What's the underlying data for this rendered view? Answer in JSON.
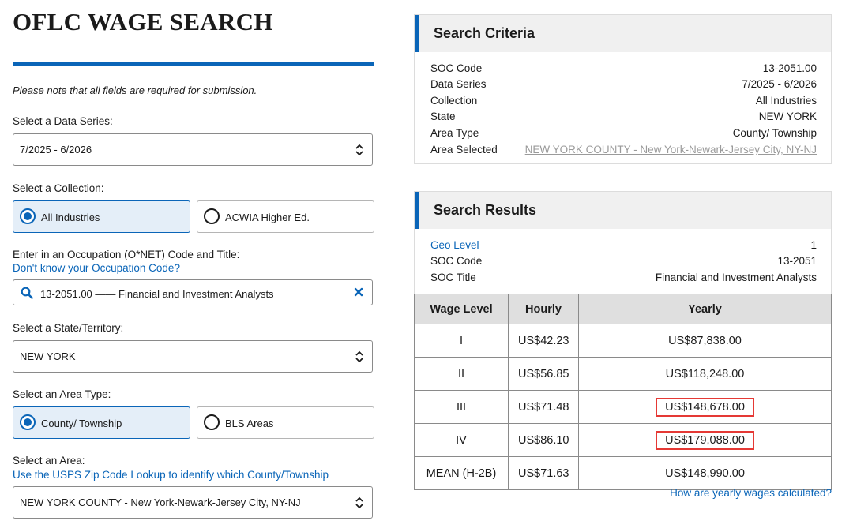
{
  "form": {
    "title": "OFLC WAGE SEARCH",
    "note": "Please note that all fields are required for submission.",
    "data_series": {
      "label": "Select a Data Series:",
      "value": "7/2025 - 6/2026"
    },
    "collection": {
      "label": "Select a Collection:",
      "options": [
        "All Industries",
        "ACWIA Higher Ed."
      ],
      "selected": "All Industries"
    },
    "occupation": {
      "label": "Enter in an Occupation (O*NET) Code and Title:",
      "help_link": "Don't know your Occupation Code?",
      "value": "13-2051.00 —— Financial and Investment Analysts"
    },
    "state": {
      "label": "Select a State/Territory:",
      "value": "NEW YORK"
    },
    "area_type": {
      "label": "Select an Area Type:",
      "options": [
        "County/ Township",
        "BLS Areas"
      ],
      "selected": "County/ Township"
    },
    "area": {
      "label": "Select an Area:",
      "help_link": "Use the USPS Zip Code Lookup to identify which County/Township",
      "value": "NEW YORK COUNTY - New York-Newark-Jersey City, NY-NJ"
    }
  },
  "criteria": {
    "heading": "Search Criteria",
    "rows": [
      {
        "k": "SOC Code",
        "v": "13-2051.00"
      },
      {
        "k": "Data Series",
        "v": "7/2025 - 6/2026"
      },
      {
        "k": "Collection",
        "v": "All Industries"
      },
      {
        "k": "State",
        "v": "NEW YORK"
      },
      {
        "k": "Area Type",
        "v": "County/ Township"
      },
      {
        "k": "Area Selected",
        "v": "NEW YORK COUNTY - New York-Newark-Jersey City, NY-NJ"
      }
    ]
  },
  "results": {
    "heading": "Search Results",
    "rows": [
      {
        "k": "Geo Level",
        "v": "1"
      },
      {
        "k": "SOC Code",
        "v": "13-2051"
      },
      {
        "k": "SOC Title",
        "v": "Financial and Investment Analysts"
      }
    ],
    "table": {
      "headers": [
        "Wage Level",
        "Hourly",
        "Yearly"
      ],
      "rows": [
        {
          "level": "I",
          "hourly": "US$42.23",
          "yearly": "US$87,838.00"
        },
        {
          "level": "II",
          "hourly": "US$56.85",
          "yearly": "US$118,248.00"
        },
        {
          "level": "III",
          "hourly": "US$71.48",
          "yearly": "US$148,678.00"
        },
        {
          "level": "IV",
          "hourly": "US$86.10",
          "yearly": "US$179,088.00"
        },
        {
          "level": "MEAN (H-2B)",
          "hourly": "US$71.63",
          "yearly": "US$148,990.00"
        }
      ]
    },
    "footer_link": "How are yearly wages calculated?"
  },
  "colors": {
    "accent": "#0a65b8",
    "highlight": "#e53935"
  }
}
